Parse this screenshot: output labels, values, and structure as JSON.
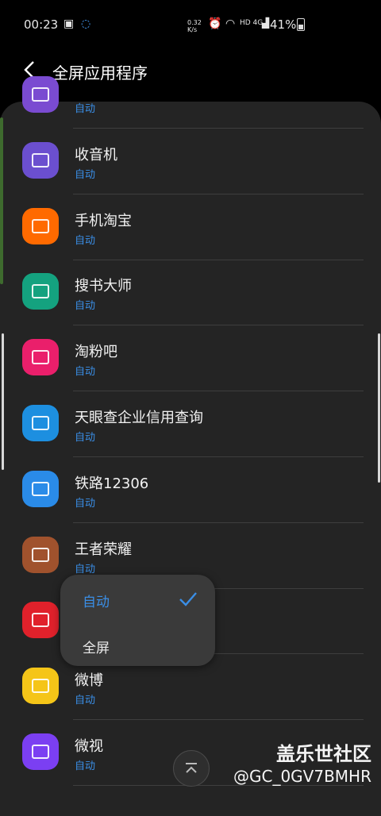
{
  "status_bar": {
    "time": "00:23",
    "net_speed": "0.32 K/s",
    "network": "HD 4G",
    "battery": "41%"
  },
  "header": {
    "title": "全屏应用程序"
  },
  "apps": [
    {
      "name": "",
      "mode": "自动",
      "icon": "purple-app-icon",
      "color": "#7a4bd1"
    },
    {
      "name": "收音机",
      "mode": "自动",
      "icon": "radio-icon",
      "color": "#6b4fcf"
    },
    {
      "name": "手机淘宝",
      "mode": "自动",
      "icon": "taobao-icon",
      "color": "#ff6a00"
    },
    {
      "name": "搜书大师",
      "mode": "自动",
      "icon": "book-icon",
      "color": "#14a27f"
    },
    {
      "name": "淘粉吧",
      "mode": "自动",
      "icon": "taofenba-icon",
      "color": "#ea1f6b"
    },
    {
      "name": "天眼查企业信用查询",
      "mode": "自动",
      "icon": "tianyancha-icon",
      "color": "#1d8fe0"
    },
    {
      "name": "铁路12306",
      "mode": "自动",
      "icon": "railway-icon",
      "color": "#2a8be8"
    },
    {
      "name": "王者荣耀",
      "mode": "自动",
      "icon": "game-avatar-icon",
      "color": "#a0522d"
    },
    {
      "name": "",
      "mode": "",
      "icon": "netease-music-icon",
      "color": "#e0212b"
    },
    {
      "name": "微博",
      "mode": "自动",
      "icon": "weibo-icon",
      "color": "#f5c518"
    },
    {
      "name": "微视",
      "mode": "自动",
      "icon": "weishi-icon",
      "color": "#7b3ff2"
    }
  ],
  "popup": {
    "option_auto": "自动",
    "option_full": "全屏"
  },
  "watermark": {
    "line1": "盖乐世社区",
    "line2": "@GC_0GV7BMHR"
  }
}
